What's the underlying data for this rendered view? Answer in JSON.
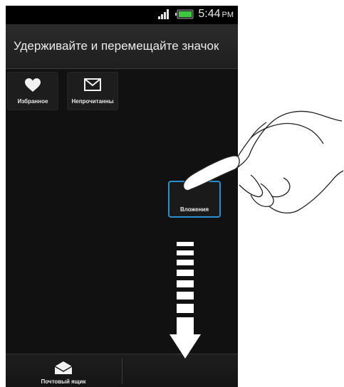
{
  "status_bar": {
    "time": "5:44",
    "ampm": "PM",
    "signal_icon": "signal-bars-icon",
    "battery_icon": "battery-icon",
    "accent_color": "#3cc83c"
  },
  "header": {
    "title": "Удерживайте и перемещайте значок"
  },
  "tiles": [
    {
      "label": "Избранное",
      "icon": "heart-icon"
    },
    {
      "label": "Непрочитанны",
      "icon": "envelope-icon"
    }
  ],
  "dragged_tile": {
    "label": "Вложения",
    "highlight_color": "#2a8fd0"
  },
  "bottom_bar": {
    "mailbox_label": "Почтовый ящик",
    "mailbox_icon": "open-envelope-icon"
  },
  "overlay": {
    "arrow_icon": "down-arrow-icon",
    "hand_icon": "pointing-hand-icon"
  }
}
